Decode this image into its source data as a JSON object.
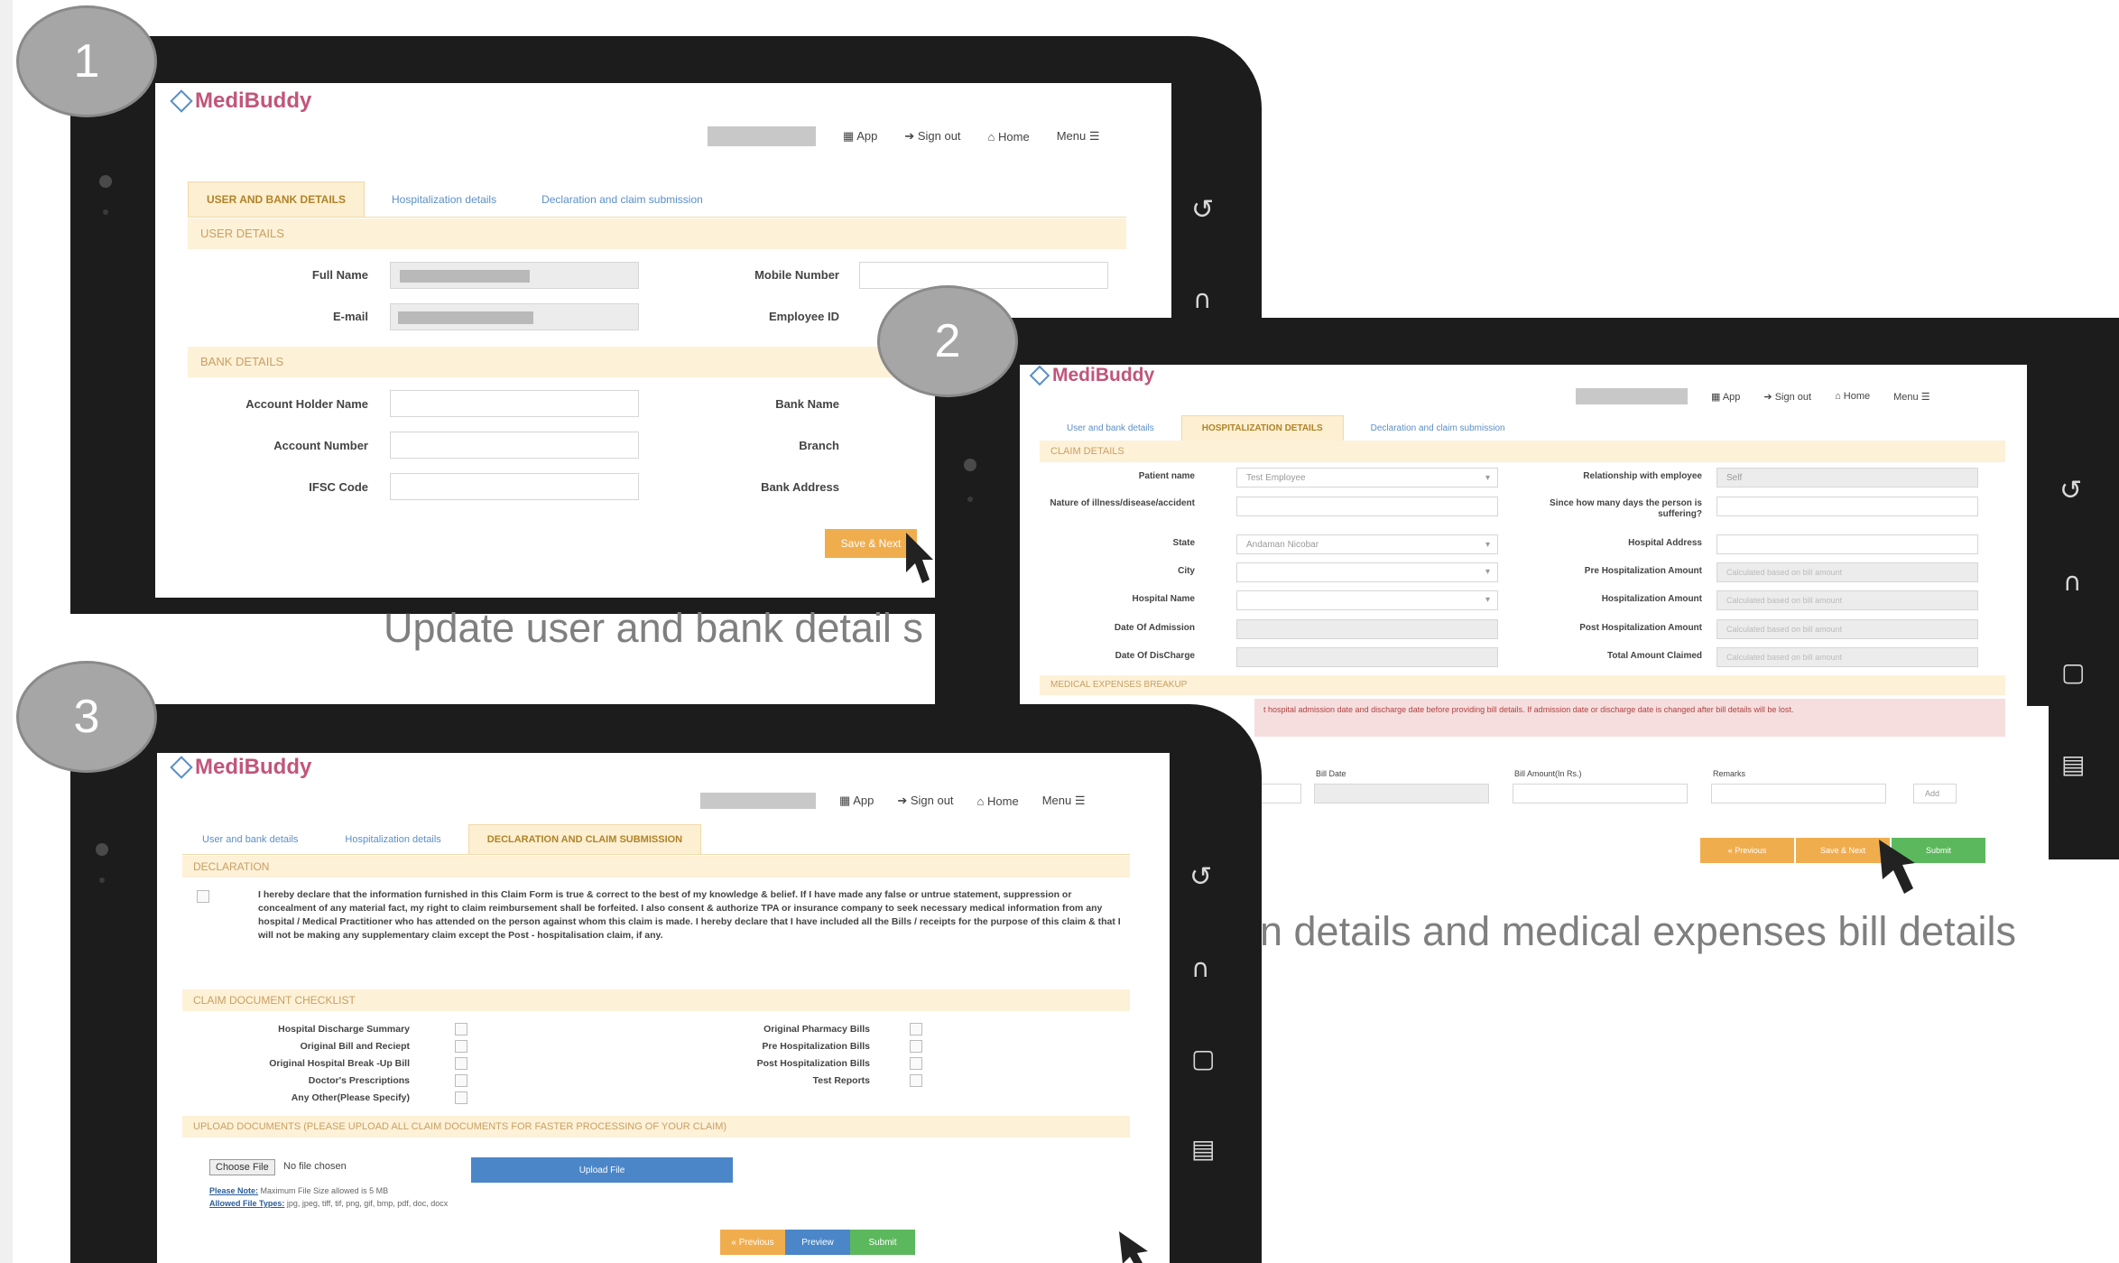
{
  "slides": {
    "step1": {
      "number": "1",
      "caption": "Update user and bank detail s"
    },
    "step2": {
      "number": "2",
      "caption": "n details and medical expenses bill details"
    },
    "step3": {
      "number": "3"
    }
  },
  "common": {
    "logo": "MediBuddy",
    "nav": {
      "app": "App",
      "signout": "Sign out",
      "home": "Home",
      "menu": "Menu"
    }
  },
  "screen1": {
    "tabs": [
      "USER AND BANK DETAILS",
      "Hospitalization details",
      "Declaration and claim submission"
    ],
    "user_section": "USER DETAILS",
    "bank_section": "BANK DETAILS",
    "labels": {
      "full_name": "Full Name",
      "email": "E-mail",
      "mobile": "Mobile Number",
      "employee_id": "Employee ID",
      "account_holder": "Account Holder Name",
      "account_number": "Account Number",
      "ifsc": "IFSC Code",
      "bank_name": "Bank Name",
      "branch": "Branch",
      "bank_address": "Bank Address"
    },
    "save_next": "Save & Next"
  },
  "screen2": {
    "tabs": [
      "User and bank details",
      "HOSPITALIZATION DETAILS",
      "Declaration and claim submission"
    ],
    "claim_section": "CLAIM DETAILS",
    "labels": {
      "patient_name": "Patient name",
      "nature": "Nature of illness/disease/accident",
      "state": "State",
      "city": "City",
      "hospital_name": "Hospital Name",
      "date_admission": "Date Of Admission",
      "date_discharge": "Date Of DisCharge",
      "relationship": "Relationship with employee",
      "since_days": "Since how many days the person is suffering?",
      "hospital_address": "Hospital Address",
      "pre_hosp": "Pre Hospitalization Amount",
      "hosp_amount": "Hospitalization Amount",
      "post_hosp": "Post Hospitalization Amount",
      "total_claimed": "Total Amount Claimed"
    },
    "values": {
      "patient_name": "Test Employee",
      "state": "Andaman Nicobar",
      "relationship": "Self",
      "calc_placeholder": "Calculated based on bill amount"
    },
    "medical_section": "MEDICAL EXPENSES BREAKUP",
    "warning": "t hospital admission date and discharge date before providing bill details. If admission date or discharge date is changed after bill details will be lost.",
    "bill_cols": [
      "Bill Date",
      "Bill Amount(In Rs.)",
      "Remarks"
    ],
    "add_label": "Add",
    "buttons": {
      "previous": "« Previous",
      "save_next": "Save & Next",
      "submit": "Submit"
    }
  },
  "screen3": {
    "tabs": [
      "User and bank details",
      "Hospitalization details",
      "DECLARATION AND CLAIM SUBMISSION"
    ],
    "declaration_section": "DECLARATION",
    "declaration_text": "I hereby declare that the information furnished in this Claim Form is true & correct to the best of my knowledge & belief. If I have made any false or untrue statement, suppression or concealment of any material fact, my right to claim reimbursement shall be forfeited. I also consent & authorize TPA or insurance company to seek necessary medical information from any hospital / Medical Practitioner who has attended on the person against whom this claim is made. I hereby declare that I have included all the Bills / receipts for the purpose of this claim & that I will not be making any supplementary claim except the Post - hospitalisation claim, if any.",
    "checklist_section": "CLAIM DOCUMENT CHECKLIST",
    "checklist_left": [
      "Hospital Discharge Summary",
      "Original Bill and Reciept",
      "Original Hospital Break -Up Bill",
      "Doctor's Prescriptions",
      "Any Other(Please Specify)"
    ],
    "checklist_right": [
      "Original Pharmacy Bills",
      "Pre Hospitalization Bills",
      "Post Hospitalization Bills",
      "Test Reports"
    ],
    "upload_section": "UPLOAD DOCUMENTS (PLEASE UPLOAD ALL CLAIM DOCUMENTS FOR FASTER PROCESSING OF YOUR CLAIM)",
    "choose_file": "Choose File",
    "no_file": "No file chosen",
    "upload_btn": "Upload File",
    "note_label": "Please Note:",
    "note_text": "Maximum File Size allowed is 5 MB",
    "types_label": "Allowed File Types:",
    "types_text": "jpg, jpeg, tiff, tif, png, gif, bmp, pdf, doc, docx",
    "buttons": {
      "previous": "« Previous",
      "preview": "Preview",
      "submit": "Submit"
    }
  },
  "colors": {
    "accent_orange": "#f0ad4e",
    "accent_green": "#5cb85c",
    "accent_blue": "#4a86c8",
    "logo_pink": "#c2557a"
  }
}
